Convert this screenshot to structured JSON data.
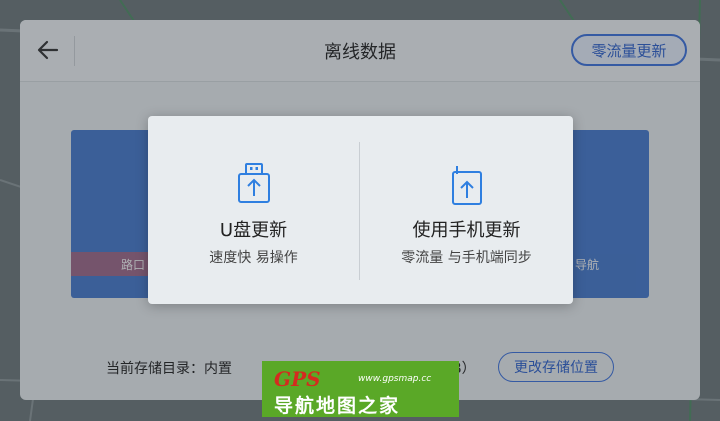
{
  "header": {
    "title": "离线数据",
    "zero_flow_button": "零流量更新"
  },
  "cards": {
    "left_sub": "路口",
    "right_sub": "导航"
  },
  "storage": {
    "label": "当前存储目录：内置",
    "tail": "B）",
    "change_button": "更改存储位置"
  },
  "modal": {
    "usb": {
      "title": "U盘更新",
      "desc": "速度快 易操作",
      "icon": "usb-icon"
    },
    "phone": {
      "title": "使用手机更新",
      "desc": "零流量 与手机端同步",
      "icon": "phone-upload-icon"
    }
  },
  "watermark": {
    "brand": "GPS",
    "url": "www.gpsmap.cc",
    "name": "导航地图之家"
  },
  "colors": {
    "accent": "#3b6fd8",
    "icon_blue": "#2f7fe0",
    "card_blue": "#2f67c4"
  }
}
